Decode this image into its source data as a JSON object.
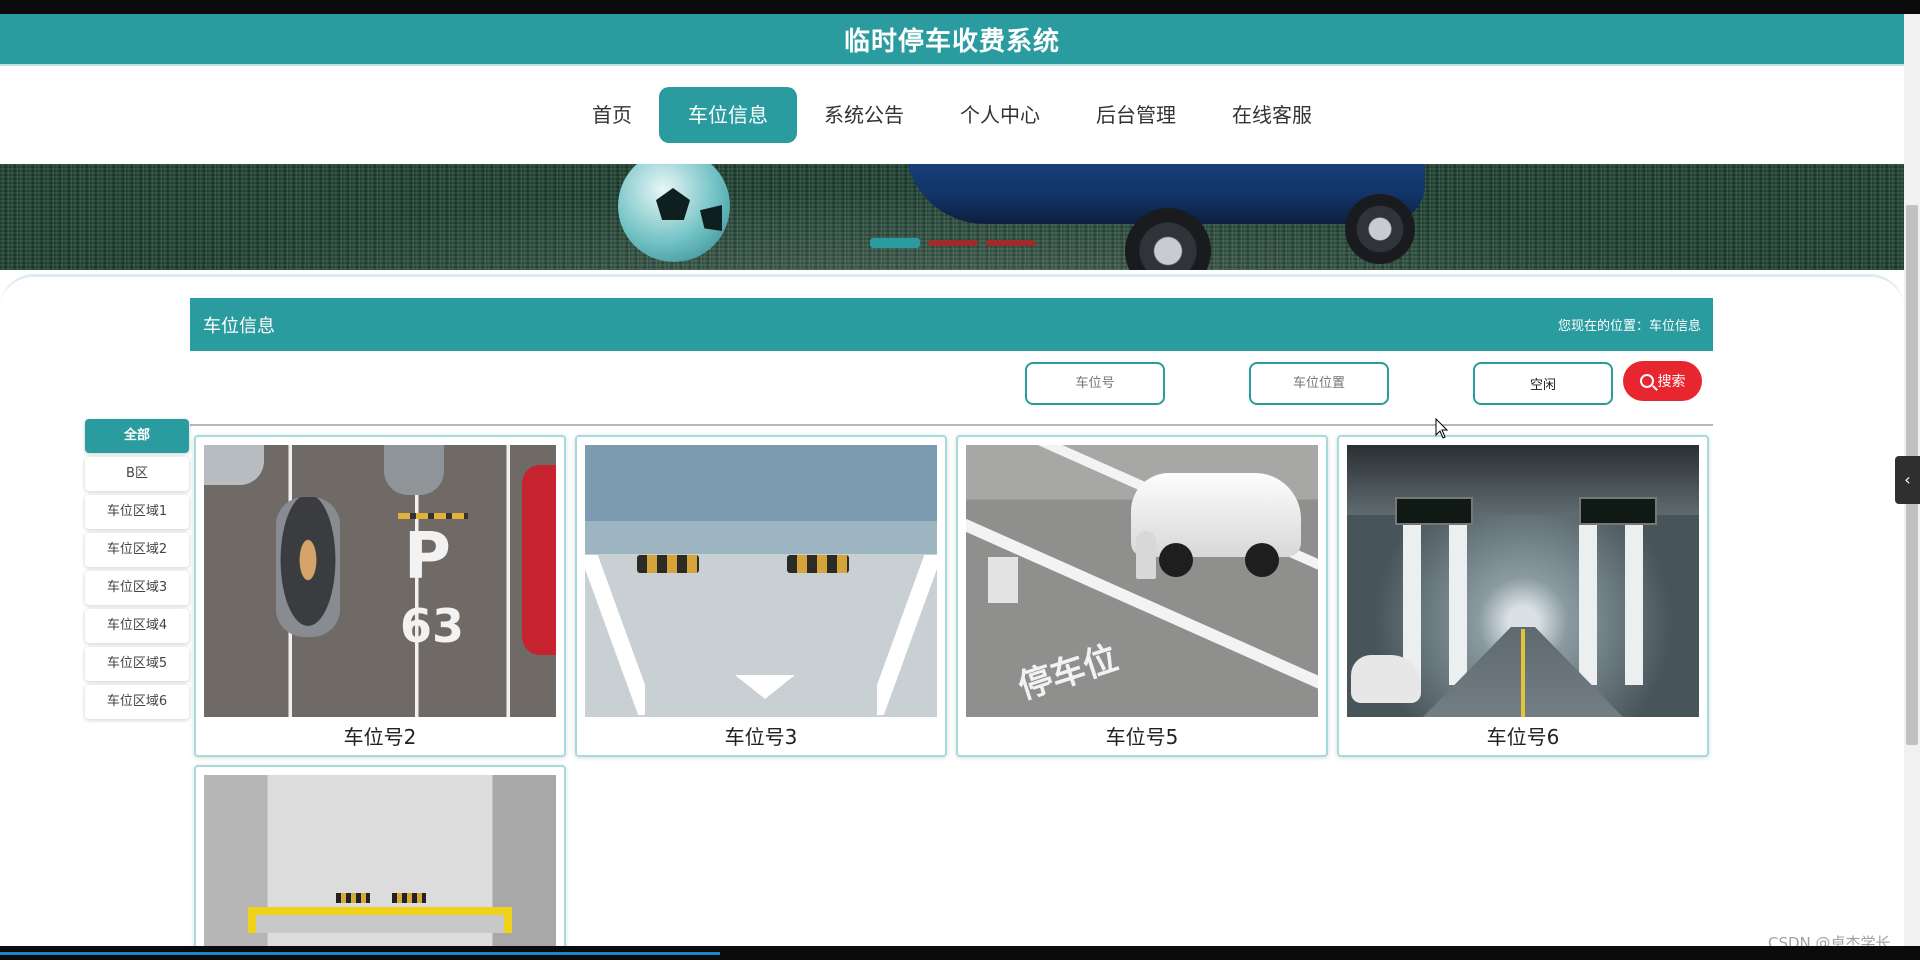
{
  "header": {
    "title": "临时停车收费系统"
  },
  "nav": {
    "items": [
      "首页",
      "车位信息",
      "系统公告",
      "个人中心",
      "后台管理",
      "在线客服"
    ],
    "active_index": 1
  },
  "banner": {
    "slide_count": 3,
    "active_slide": 0
  },
  "section": {
    "title": "车位信息",
    "location": "您现在的位置：车位信息"
  },
  "filters": {
    "spot_number_placeholder": "车位号",
    "spot_location_placeholder": "车位位置",
    "status_value": "空闲",
    "search_label": "搜索"
  },
  "sidebar": {
    "items": [
      "全部",
      "B区",
      "车位区域1",
      "车位区域2",
      "车位区域3",
      "车位区域4",
      "车位区域5",
      "车位区域6"
    ],
    "active_index": 0
  },
  "cards": [
    {
      "label": "车位号2",
      "photo": "top-down-parking-lot"
    },
    {
      "label": "车位号3",
      "photo": "empty-parking-space"
    },
    {
      "label": "车位号5",
      "photo": "parking-space-with-lock"
    },
    {
      "label": "车位号6",
      "photo": "underground-garage"
    },
    {
      "label": "",
      "photo": "indoor-parking-bay"
    }
  ],
  "photo_text": {
    "p_letter": "P",
    "p_number": "63",
    "paint_text": "停车位"
  },
  "watermark": "CSDN @卓杰学长",
  "colors": {
    "primary": "#2a9c9f",
    "search": "#e8262f",
    "banner_dot_inactive": "#a02b2b"
  }
}
